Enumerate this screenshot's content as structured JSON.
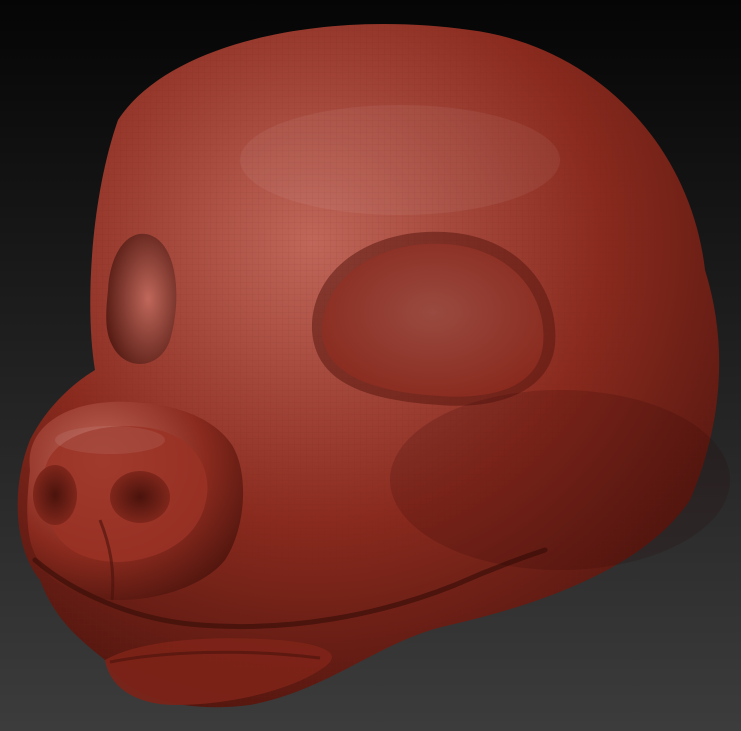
{
  "viewport": {
    "background_top": "#050505",
    "background_bottom": "#3c3c3c",
    "model": {
      "subject": "sculpted-animal-head-mask",
      "material_base": "#8a2a1e",
      "material_dark": "#4a130c",
      "material_highlight": "#c0675a",
      "eye_socket": "#9a4a40",
      "wireframe_color": "#6e2016",
      "wireframe_visible": true
    }
  }
}
